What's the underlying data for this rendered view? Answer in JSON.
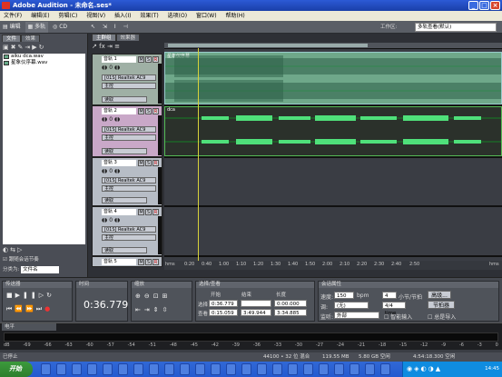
{
  "window": {
    "title": "Adobe Audition - 未命名.ses*"
  },
  "menu": [
    "文件(F)",
    "编辑(E)",
    "剪辑(C)",
    "视图(V)",
    "插入(I)",
    "效果(T)",
    "选项(O)",
    "窗口(W)",
    "帮助(H)"
  ],
  "toolbar": {
    "edit": "编辑",
    "multitrack": "多轨",
    "cd": "CD"
  },
  "workspace": {
    "label": "工作区:",
    "value": "多轨查看(默认)"
  },
  "left_panel": {
    "tabs": [
      "文件",
      "效果"
    ],
    "files": [
      "aiku dca.wav",
      "星象仪序幕.wav"
    ],
    "footer_check": "跟随会话节奏",
    "sort_label": "分类为:",
    "sort_value": "文件名"
  },
  "editor": {
    "tabs": [
      "主群组",
      "效果器"
    ]
  },
  "tracks": [
    {
      "name": "音轨 1",
      "input": "[01S] Realtek AC9",
      "output": "主控",
      "mode": "读取"
    },
    {
      "name": "音轨 2",
      "input": "[01S] Realtek AC9",
      "output": "主控",
      "mode": "读取"
    },
    {
      "name": "音轨 3",
      "input": "[01S] Realtek AC9",
      "output": "主控",
      "mode": "读取"
    },
    {
      "name": "音轨 4",
      "input": "[01S] Realtek AC9",
      "output": "主控",
      "mode": "读取"
    },
    {
      "name": "音轨 5",
      "input": "",
      "output": "",
      "mode": ""
    }
  ],
  "clips": [
    "星象仪序幕",
    "dca"
  ],
  "ruler": [
    "hms",
    "0:20",
    "0:40",
    "1:00",
    "1:10",
    "1:20",
    "1:30",
    "1:40",
    "1:50",
    "2:00",
    "2:10",
    "2:20",
    "2:30",
    "2:40",
    "2:50",
    "hms"
  ],
  "transport": {
    "title": "传送器"
  },
  "time": {
    "title": "时间",
    "value": "0:36.779"
  },
  "zoom": {
    "title": "缩放"
  },
  "selection": {
    "title": "选择/查看",
    "headers": [
      "开始",
      "结束",
      "长度"
    ],
    "sel_label": "选择",
    "view_label": "查看",
    "sel_start": "0:36.779",
    "sel_end": "",
    "sel_len": "0:00.000",
    "view_start": "0:15.059",
    "view_end": "3:49.944",
    "view_len": "3:34.885"
  },
  "session": {
    "title": "会话属性",
    "tempo_label": "速度:",
    "tempo": "150",
    "tempo_unit": "bpm",
    "beats": "4",
    "beats_unit": "小节/节拍",
    "advanced": "高级...",
    "key_label": "调:",
    "key": "(无)",
    "time_sig": "4/4 time",
    "metronome": "节拍器",
    "monitor_label": "监听:",
    "monitor": "外部",
    "smart_input": "智能输入",
    "always_input": "总是导入"
  },
  "levels": {
    "title": "电平",
    "scale": [
      "dB",
      "-69",
      "-66",
      "-63",
      "-60",
      "-57",
      "-54",
      "-51",
      "-48",
      "-45",
      "-42",
      "-39",
      "-36",
      "-33",
      "-30",
      "-27",
      "-24",
      "-21",
      "-18",
      "-15",
      "-12",
      "-9",
      "-6",
      "-3",
      "0"
    ]
  },
  "status": {
    "left": "已停止",
    "format": "44100 • 32 位 混合",
    "mem": "119.55 MB",
    "disk": "5.80 GB 空闲",
    "time_free": "4:54:18.300 空闲"
  },
  "taskbar": {
    "start": "开始",
    "clock": "14:45"
  }
}
